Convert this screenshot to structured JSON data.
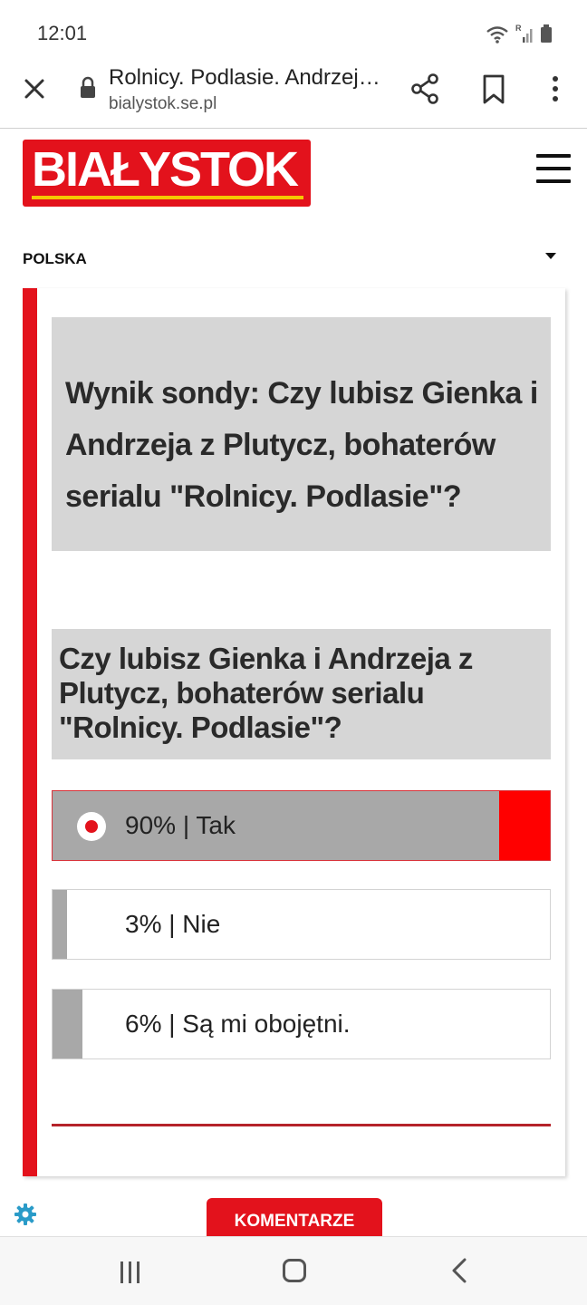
{
  "status_bar": {
    "time": "12:01",
    "icons": [
      "wifi-icon",
      "signal-icon",
      "battery-icon"
    ]
  },
  "browser": {
    "page_title": "Rolnicy. Podlasie. Andrzej i Gienek z Plutycz",
    "domain": "bialystok.se.pl",
    "icons": [
      "close-icon",
      "lock-icon",
      "share-icon",
      "bookmark-icon",
      "more-vert-icon"
    ]
  },
  "site": {
    "logo_text": "BIAŁYSTOK",
    "section": "POLSKA",
    "brand_color": "#e3121c",
    "accent_color": "#f5c800"
  },
  "poll": {
    "result_title": "Wynik sondy: Czy lubisz Gienka i Andrzeja z Plutycz, bohaterów serialu \"Rolnicy. Podlasie\"?",
    "question": "Czy lubisz Gienka i Andrzeja z Plutycz, bohaterów serialu \"Rolnicy. Podlasie\"?",
    "options": [
      {
        "label": "90% | Tak",
        "percent": 90,
        "selected": true
      },
      {
        "label": "3% | Nie",
        "percent": 3,
        "selected": false
      },
      {
        "label": "6% | Są mi obojętni.",
        "percent": 6,
        "selected": false
      }
    ]
  },
  "footer": {
    "comments_label": "KOMENTARZE"
  },
  "navigation": {
    "icons": [
      "recent-apps-icon",
      "home-icon",
      "back-icon"
    ]
  }
}
